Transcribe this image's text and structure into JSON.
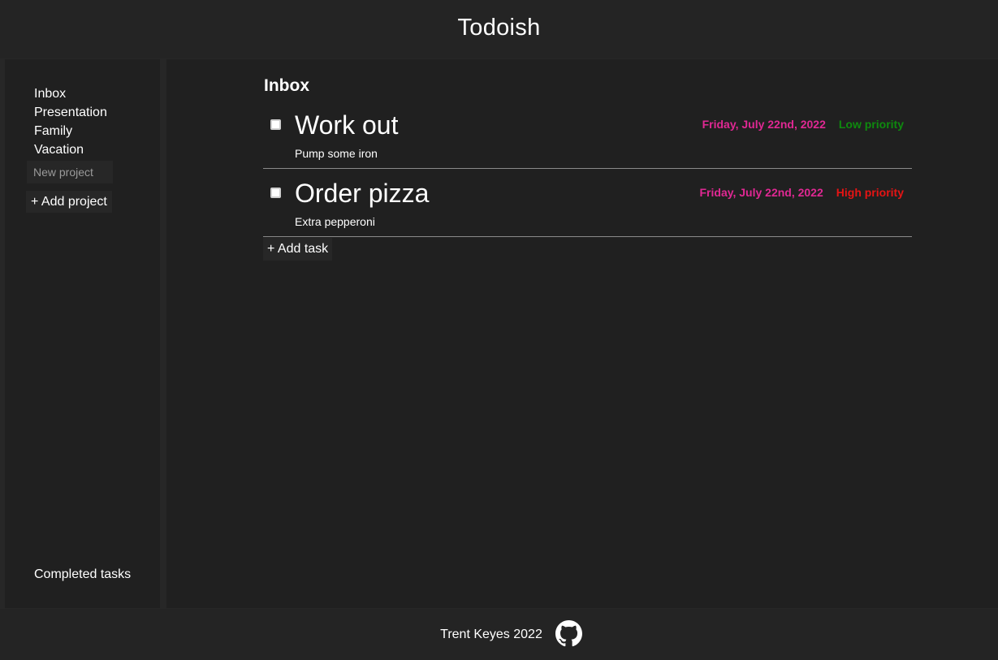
{
  "header": {
    "title": "Todoish"
  },
  "sidebar": {
    "projects": [
      {
        "label": "Inbox"
      },
      {
        "label": "Presentation"
      },
      {
        "label": "Family"
      },
      {
        "label": "Vacation"
      }
    ],
    "new_project_placeholder": "New project",
    "add_project_label": "+ Add project",
    "completed_tasks_label": "Completed tasks"
  },
  "main": {
    "title": "Inbox",
    "tasks": [
      {
        "title": "Work out",
        "description": "Pump some iron",
        "due_date": "Friday, July 22nd, 2022",
        "priority": "Low priority",
        "priority_color": "#0e8a0e",
        "completed": false
      },
      {
        "title": "Order pizza",
        "description": "Extra pepperoni",
        "due_date": "Friday, July 22nd, 2022",
        "priority": "High priority",
        "priority_color": "#e61414",
        "completed": false
      }
    ],
    "add_task_label": "+ Add task"
  },
  "footer": {
    "credit": "Trent Keyes 2022",
    "icon": "github-icon"
  },
  "colors": {
    "date": "#e02893",
    "background": "#202020",
    "header_background": "#242424"
  }
}
